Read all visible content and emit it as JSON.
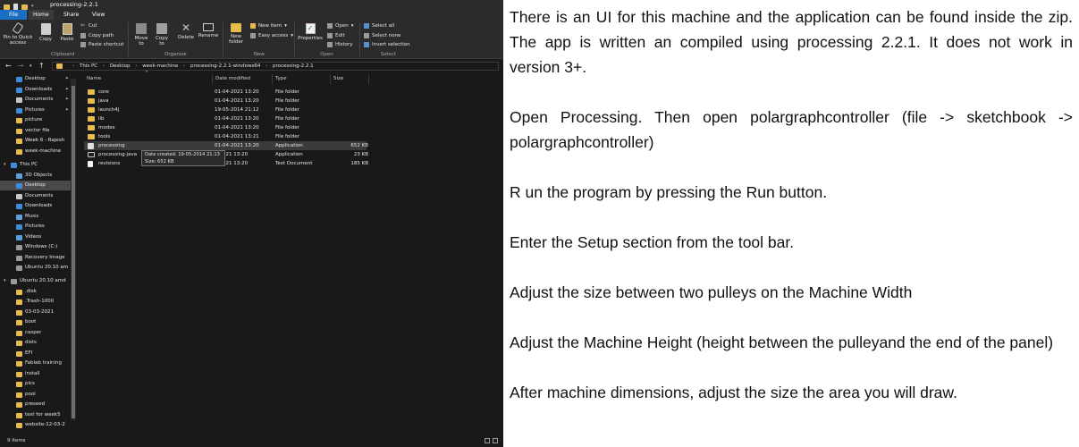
{
  "explorer": {
    "title": "processing-2.2.1",
    "tabs": [
      "File",
      "Home",
      "Share",
      "View"
    ],
    "ribbon": {
      "clipboard": {
        "pin_label": "Pin to Quick access",
        "copy_label": "Copy",
        "paste_label": "Paste",
        "cut_label": "Cut",
        "copy_path_label": "Copy path",
        "paste_shortcut_label": "Paste shortcut",
        "group_label": "Clipboard"
      },
      "organise": {
        "move_to_label": "Move to",
        "copy_to_label": "Copy to",
        "delete_label": "Delete",
        "rename_label": "Rename",
        "group_label": "Organise"
      },
      "new": {
        "new_folder_label": "New folder",
        "new_item_label": "New item",
        "easy_access_label": "Easy access",
        "group_label": "New"
      },
      "open": {
        "properties_label": "Properties",
        "open_label": "Open",
        "edit_label": "Edit",
        "history_label": "History",
        "group_label": "Open"
      },
      "select": {
        "select_all_label": "Select all",
        "select_none_label": "Select none",
        "invert_selection_label": "Invert selection",
        "group_label": "Select"
      }
    },
    "breadcrumb": [
      "This PC",
      "Desktop",
      "week-machine",
      "processing-2.2.1-windows64",
      "processing-2.2.1"
    ],
    "nav_items": [
      {
        "label": "Desktop",
        "pinned": true
      },
      {
        "label": "Downloads",
        "pinned": true
      },
      {
        "label": "Documents",
        "pinned": true
      },
      {
        "label": "Pictures",
        "pinned": true
      },
      {
        "label": "picture"
      },
      {
        "label": "vector file"
      },
      {
        "label": "Week 6 - Rajesh"
      },
      {
        "label": "week-machine"
      },
      {
        "label": "This PC"
      },
      {
        "label": "3D Objects"
      },
      {
        "label": "Desktop",
        "selected": true
      },
      {
        "label": "Documents"
      },
      {
        "label": "Downloads"
      },
      {
        "label": "Music"
      },
      {
        "label": "Pictures"
      },
      {
        "label": "Videos"
      },
      {
        "label": "Windows (C:)"
      },
      {
        "label": "Recovery Image"
      },
      {
        "label": "Ubuntu 20.10 am"
      },
      {
        "label": "Ubuntu 20.10 amd"
      },
      {
        "label": ".disk"
      },
      {
        "label": ".Trash-1000"
      },
      {
        "label": "03-03-2021"
      },
      {
        "label": "boot"
      },
      {
        "label": "casper"
      },
      {
        "label": "dists"
      },
      {
        "label": "EFI"
      },
      {
        "label": "Fablab training"
      },
      {
        "label": "install"
      },
      {
        "label": "pics"
      },
      {
        "label": "pool"
      },
      {
        "label": "preseed"
      },
      {
        "label": "test for week5"
      },
      {
        "label": "website-12-03-2"
      }
    ],
    "columns": [
      "Name",
      "Date modified",
      "Type",
      "Size"
    ],
    "files": [
      {
        "name": "core",
        "date": "01-04-2021 13:20",
        "type": "File folder",
        "size": ""
      },
      {
        "name": "java",
        "date": "01-04-2021 13:20",
        "type": "File folder",
        "size": ""
      },
      {
        "name": "launch4j",
        "date": "19-05-2014 21:12",
        "type": "File folder",
        "size": ""
      },
      {
        "name": "lib",
        "date": "01-04-2021 13:20",
        "type": "File folder",
        "size": ""
      },
      {
        "name": "modes",
        "date": "01-04-2021 13:20",
        "type": "File folder",
        "size": ""
      },
      {
        "name": "tools",
        "date": "01-04-2021 13:21",
        "type": "File folder",
        "size": ""
      },
      {
        "name": "processing",
        "date": "01-04-2021 13:20",
        "type": "Application",
        "size": "652 KB"
      },
      {
        "name": "processing-java",
        "date": "4-2021 13:20",
        "type": "Application",
        "size": "23 KB"
      },
      {
        "name": "revisions",
        "date": "4-2021 13:20",
        "type": "Text Document",
        "size": "185 KB"
      }
    ],
    "tooltip": {
      "line1": "Date created: 19-05-2014 21:13",
      "line2": "Size: 652 KB"
    },
    "status": "9 items",
    "colors": {
      "background": "#191919",
      "folder": "#e8bb4e",
      "file_tab": "#1a6fc4"
    }
  },
  "instructions": [
    "There is an UI for this machine and the application can be found inside the zip. The app is written an compiled using processing 2.2.1. It does not work in version 3+.",
    "Open Processing. Then open polargraphcontroller (file -> sketchbook -> polargraphcontroller)",
    "R un the program by pressing the Run button.",
    "Enter the Setup section from the tool bar.",
    "Adjust the size between two pulleys on the Machine Width",
    "Adjust the Machine Height (height between the pulleyand the end of the panel)",
    "After machine dimensions, adjust the size the area you will draw."
  ]
}
